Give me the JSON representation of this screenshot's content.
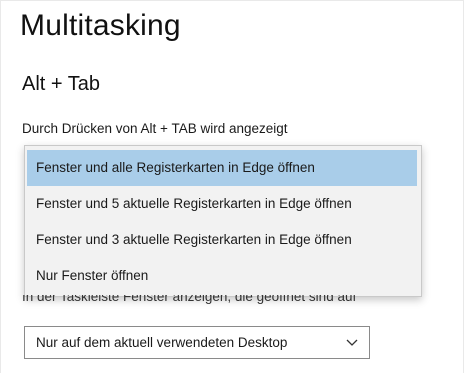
{
  "page": {
    "title": "Multitasking"
  },
  "alt_tab": {
    "section_title": "Alt + Tab",
    "label": "Durch Drücken von Alt + TAB wird angezeigt",
    "options": [
      {
        "label": "Fenster und alle Registerkarten in Edge öffnen",
        "selected": true
      },
      {
        "label": "Fenster und 5 aktuelle Registerkarten in Edge öffnen",
        "selected": false
      },
      {
        "label": "Fenster und 3 aktuelle Registerkarten in Edge öffnen",
        "selected": false
      },
      {
        "label": "Nur Fenster öffnen",
        "selected": false
      }
    ]
  },
  "taskbar": {
    "label": "In der Taskleiste Fenster anzeigen, die geöffnet sind auf",
    "selected_value": "Nur auf dem aktuell verwendeten Desktop",
    "chevron_icon": "chevron-down-icon"
  },
  "colors": {
    "selected_option_bg": "#a9cde9",
    "menu_bg": "#f2f2f2"
  }
}
